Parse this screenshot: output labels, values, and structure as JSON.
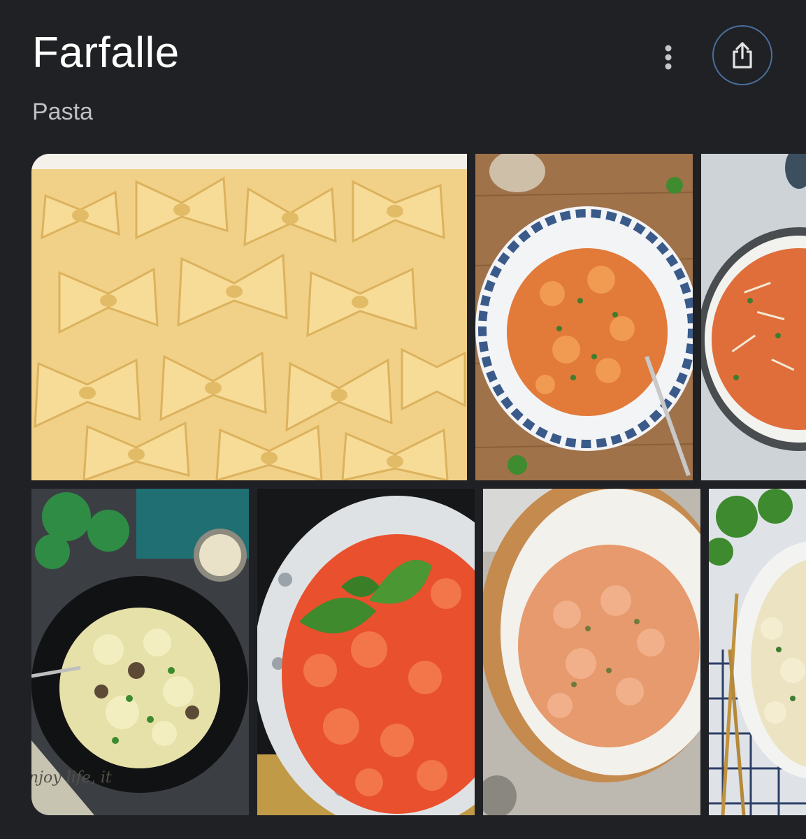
{
  "header": {
    "title": "Farfalle",
    "subtitle": "Pasta"
  },
  "actions": {
    "more_icon": "more-vert-icon",
    "share_icon": "share-icon"
  },
  "gallery": {
    "images": [
      {
        "subject": "uncooked farfalle pasta"
      },
      {
        "subject": "farfalle in tomato sauce on blue patterned plate"
      },
      {
        "subject": "farfalle in creamy tomato sauce with parmesan"
      },
      {
        "subject": "farfalle with mushrooms in black bowl"
      },
      {
        "subject": "farfalle in tomato sauce with basil"
      },
      {
        "subject": "farfalle in creamy pink sauce"
      },
      {
        "subject": "farfalle with herbs and forks"
      }
    ],
    "tile4_caption": "njoy life, it"
  },
  "colors": {
    "background": "#202124",
    "share_ring": "#4a6e9e"
  }
}
